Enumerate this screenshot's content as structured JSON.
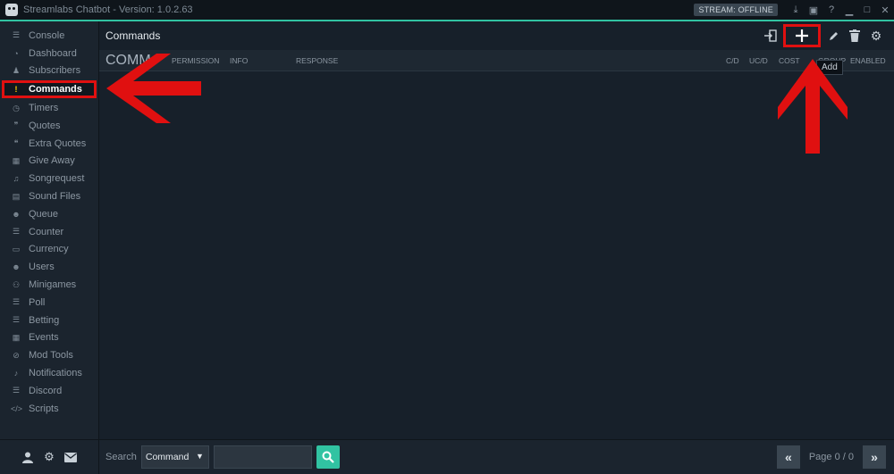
{
  "window": {
    "title": "Streamlabs Chatbot - Version: 1.0.2.63",
    "stream_status": "STREAM: OFFLINE"
  },
  "sidebar": {
    "items": [
      {
        "label": "Console",
        "icon": "menu-icon"
      },
      {
        "label": "Dashboard",
        "icon": "dashboard-icon"
      },
      {
        "label": "Subscribers",
        "icon": "subscriber-icon"
      },
      {
        "label": "Commands",
        "icon": "exclamation-icon",
        "active": true
      },
      {
        "label": "Timers",
        "icon": "clock-icon"
      },
      {
        "label": "Quotes",
        "icon": "quote-icon"
      },
      {
        "label": "Extra Quotes",
        "icon": "quote-icon"
      },
      {
        "label": "Give Away",
        "icon": "gift-icon"
      },
      {
        "label": "Songrequest",
        "icon": "music-icon"
      },
      {
        "label": "Sound Files",
        "icon": "file-icon"
      },
      {
        "label": "Queue",
        "icon": "users-icon"
      },
      {
        "label": "Counter",
        "icon": "menu-icon"
      },
      {
        "label": "Currency",
        "icon": "money-icon"
      },
      {
        "label": "Users",
        "icon": "users-icon"
      },
      {
        "label": "Minigames",
        "icon": "gamepad-icon"
      },
      {
        "label": "Poll",
        "icon": "menu-icon"
      },
      {
        "label": "Betting",
        "icon": "menu-icon"
      },
      {
        "label": "Events",
        "icon": "calendar-icon"
      },
      {
        "label": "Mod Tools",
        "icon": "ban-icon"
      },
      {
        "label": "Notifications",
        "icon": "bell-icon"
      },
      {
        "label": "Discord",
        "icon": "menu-icon"
      },
      {
        "label": "Scripts",
        "icon": "code-icon"
      }
    ]
  },
  "main": {
    "title": "Commands",
    "tooltip": "Add",
    "columns": {
      "command": "COMM",
      "permission": "PERMISSION",
      "info": "INFO",
      "response": "RESPONSE",
      "cd": "C/D",
      "ucd": "UC/D",
      "cost": "COST",
      "group": "GROUP",
      "enabled": "ENABLED"
    }
  },
  "bottom": {
    "search_label": "Search",
    "search_field_selected": "Command",
    "search_value": "",
    "page_label": "Page 0 / 0"
  },
  "colors": {
    "accent": "#31c3a2",
    "highlight": "#e01010",
    "active_icon": "#ffd100"
  }
}
